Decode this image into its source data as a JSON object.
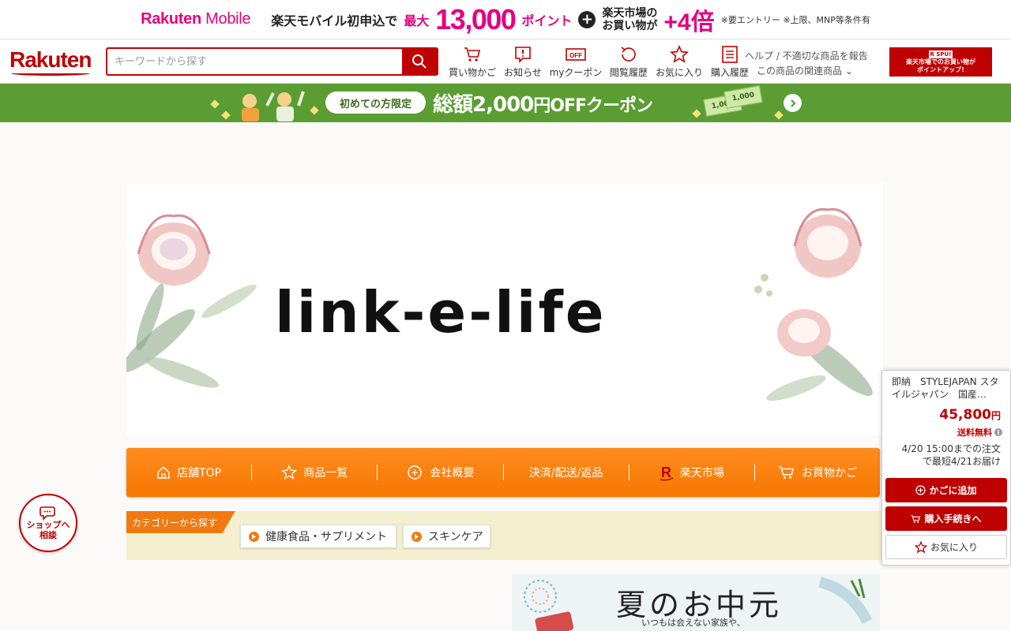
{
  "colors": {
    "brand": "#bf0000",
    "mobile_pink": "#e5007f",
    "coupon_green": "#5b9d32",
    "nav_orange": "#f77700"
  },
  "promo": {
    "brand_bold": "Rakuten",
    "brand_thin": " Mobile",
    "lead": "楽天モバイル初申込で",
    "max": "最大",
    "amount": "13,000",
    "points": "ポイント",
    "plus": "+",
    "line1": "楽天市場の",
    "line2a": "お買い物が",
    "multiplier": "+4倍",
    "note": "※要エントリー ※上限、MNP等条件有"
  },
  "header": {
    "logo": "Rakuten",
    "search_placeholder": "キーワードから探す",
    "nav": [
      {
        "label": "買い物かご",
        "icon": "cart-icon"
      },
      {
        "label": "お知らせ",
        "icon": "notification-icon"
      },
      {
        "label": "myクーポン",
        "icon": "coupon-icon"
      },
      {
        "label": "閲覧履歴",
        "icon": "history-icon"
      },
      {
        "label": "お気に入り",
        "icon": "star-icon"
      },
      {
        "label": "購入履歴",
        "icon": "list-icon"
      }
    ],
    "coupon_icon_text": "OFF",
    "help_line1": "ヘルプ / 不適切な商品を報告",
    "help_line2": "この商品の関連商品",
    "spu_tag": "R SPU!",
    "spu_line1": "楽天市場でのお買い物が",
    "spu_line2": "ポイントアップ!"
  },
  "coupon_strip": {
    "pill": "初めての方限定",
    "msg_pre": "総額",
    "msg_amount": "2,000",
    "msg_yen": "円",
    "msg_post": "OFFクーポン",
    "bill_value": "1,000"
  },
  "shop": {
    "name": "link-e-life"
  },
  "shop_nav": [
    {
      "label": "店舗TOP",
      "icon": "home-icon"
    },
    {
      "label": "商品一覧",
      "icon": "star-outline-icon"
    },
    {
      "label": "会社概要",
      "icon": "company-icon"
    },
    {
      "label": "決済/配送/返品",
      "icon": ""
    },
    {
      "label": "楽天市場",
      "icon": "rakuten-r-icon"
    },
    {
      "label": "お買物かご",
      "icon": "cart-icon"
    }
  ],
  "category": {
    "tag": "カテゴリーから探す",
    "items": [
      "健康食品・サプリメント",
      "スキンケア"
    ]
  },
  "summer_banner": {
    "title": "夏のお中元",
    "sub": "いつもは会えない家族や、"
  },
  "consult": {
    "line1": "ショップへ",
    "line2": "相談"
  },
  "float_panel": {
    "title": "即納　STYLEJAPAN スタイルジャパン　国産…",
    "price": "45,800",
    "yen": "円",
    "shipping": "送料無料",
    "delivery_line1": "4/20 15:00までの注文",
    "delivery_line2": "で最短4/21お届け",
    "add_to_cart": "かごに追加",
    "checkout": "購入手続きへ",
    "favorite": "お気に入り"
  }
}
